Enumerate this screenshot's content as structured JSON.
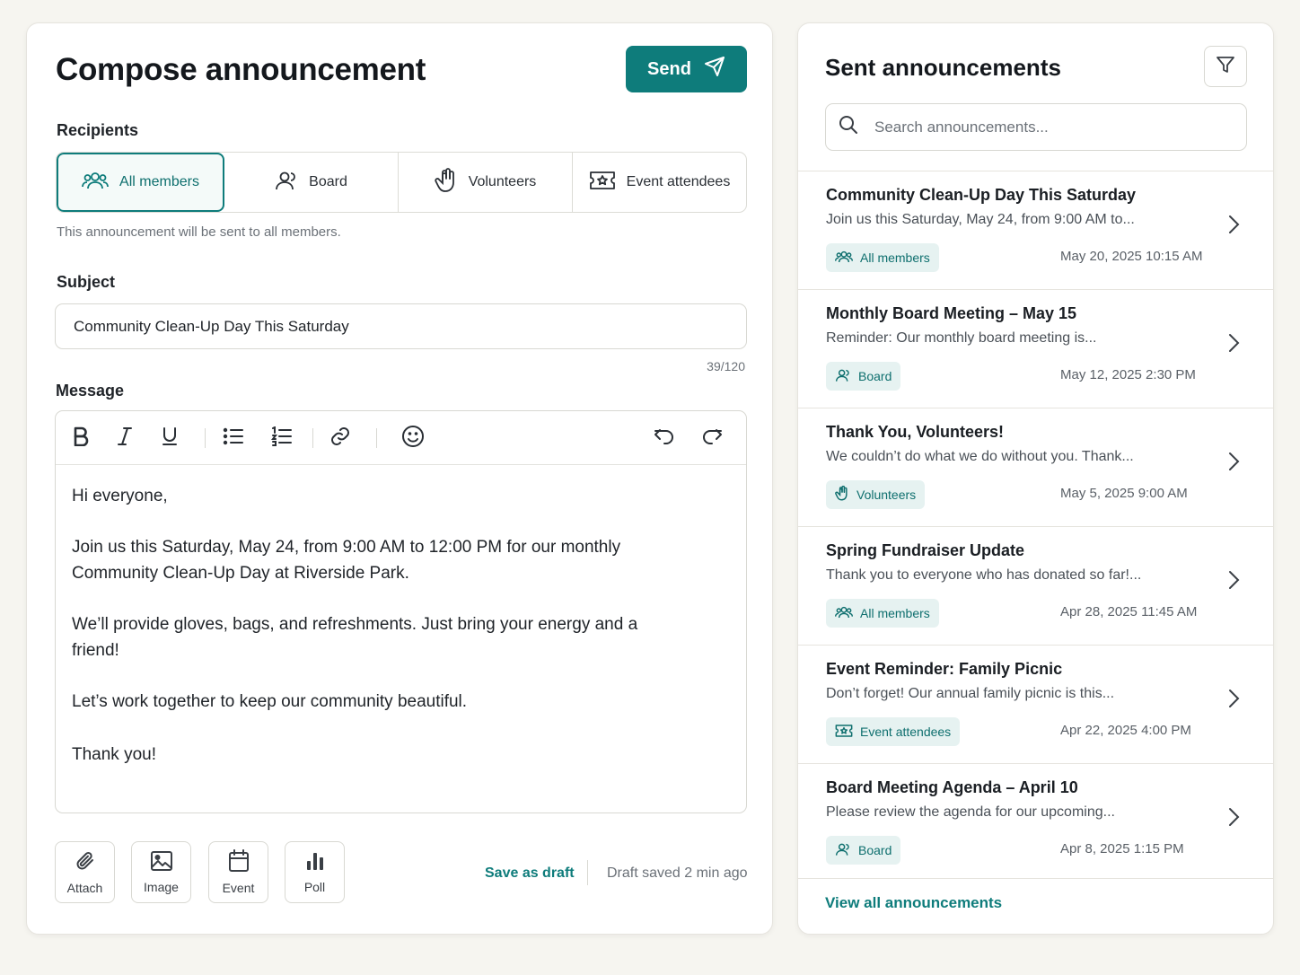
{
  "compose": {
    "title": "Compose announcement",
    "send_label": "Send",
    "recipients_label": "Recipients",
    "recipients": [
      {
        "label": "All members",
        "icon": "users-icon"
      },
      {
        "label": "Board",
        "icon": "user-icon"
      },
      {
        "label": "Volunteers",
        "icon": "hand-icon"
      },
      {
        "label": "Event attendees",
        "icon": "ticket-icon"
      }
    ],
    "selected_recipient": "All members",
    "recipient_hint": "This announcement will be sent to all members.",
    "subject_label": "Subject",
    "subject_value": "Community Clean-Up Day This Saturday",
    "subject_counter": "39/120",
    "message_label": "Message",
    "message_paragraphs": [
      "Hi everyone,",
      "Join us this Saturday, May 24, from 9:00 AM to 12:00 PM for our monthly Community Clean-Up Day at Riverside Park.",
      "We’ll provide gloves, bags, and refreshments. Just bring your energy and a friend!",
      "Let’s work together to keep our community beautiful.",
      "Thank you!"
    ],
    "attachments": [
      {
        "label": "Attach",
        "icon": "paperclip-icon"
      },
      {
        "label": "Image",
        "icon": "image-icon"
      },
      {
        "label": "Event",
        "icon": "calendar-icon"
      },
      {
        "label": "Poll",
        "icon": "bar-chart-icon"
      }
    ],
    "save_draft_label": "Save as draft",
    "draft_status": "Draft saved 2 min ago"
  },
  "sent": {
    "title": "Sent announcements",
    "search_placeholder": "Search announcements...",
    "items": [
      {
        "title": "Community Clean-Up Day This Saturday",
        "preview": "Join us this Saturday, May 24, from 9:00 AM to...",
        "tag": "All members",
        "date": "May 20, 2025  10:15 AM"
      },
      {
        "title": "Monthly Board Meeting – May 15",
        "preview": "Reminder: Our monthly board meeting is...",
        "tag": "Board",
        "date": "May 12, 2025  2:30 PM"
      },
      {
        "title": "Thank You, Volunteers!",
        "preview": "We couldn’t do what we do without you. Thank...",
        "tag": "Volunteers",
        "date": "May 5, 2025  9:00 AM"
      },
      {
        "title": "Spring Fundraiser Update",
        "preview": "Thank you to everyone who has donated so far!...",
        "tag": "All members",
        "date": "Apr 28, 2025  11:45 AM"
      },
      {
        "title": "Event Reminder: Family Picnic",
        "preview": "Don’t forget! Our annual family picnic is this...",
        "tag": "Event attendees",
        "date": "Apr 22, 2025  4:00 PM"
      },
      {
        "title": "Board Meeting Agenda – April 10",
        "preview": "Please review the agenda for our upcoming...",
        "tag": "Board",
        "date": "Apr 8, 2025  1:15 PM"
      }
    ],
    "view_all_label": "View all announcements"
  },
  "colors": {
    "accent": "#0e7c7b",
    "tag_bg": "#e6f2f1",
    "background": "#f6f5f0"
  }
}
